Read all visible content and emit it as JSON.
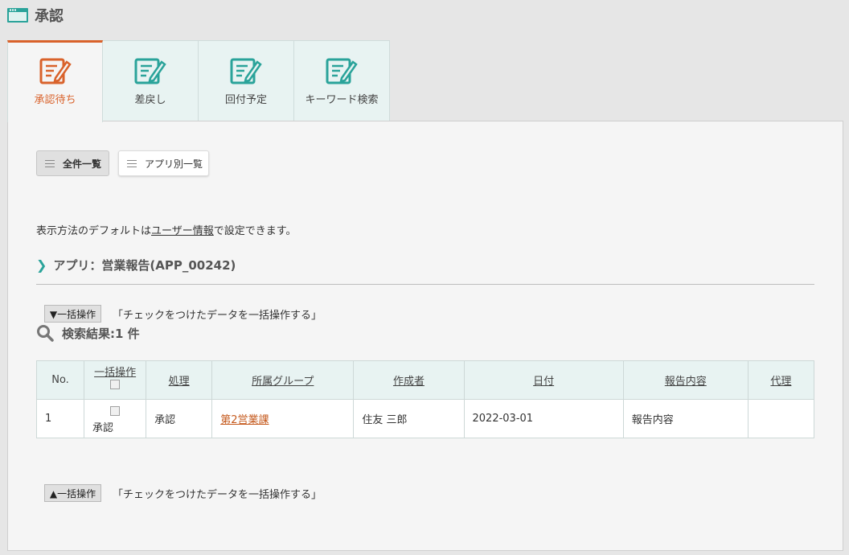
{
  "header": {
    "title": "承認",
    "icon": "window-icon",
    "accent": "#2aa39a"
  },
  "tabs": [
    {
      "label": "承認待ち",
      "icon": "edit-icon",
      "active": true
    },
    {
      "label": "差戻し",
      "icon": "edit-icon",
      "active": false
    },
    {
      "label": "回付予定",
      "icon": "edit-icon",
      "active": false
    },
    {
      "label": "キーワード検索",
      "icon": "edit-icon",
      "active": false
    }
  ],
  "view_buttons": {
    "all": "全件一覧",
    "by_app": "アプリ別一覧"
  },
  "info": {
    "prefix": "表示方法のデフォルトは",
    "link": "ユーザー情報",
    "suffix": "で設定できます。"
  },
  "app_heading": "アプリ：営業報告(APP_00242)",
  "bulk_top": {
    "button": "▼一括操作",
    "desc": "「チェックをつけたデータを一括操作する」"
  },
  "bulk_bottom": {
    "button": "▲一括操作",
    "desc": "「チェックをつけたデータを一括操作する」"
  },
  "result_title": "検索結果:1 件",
  "table": {
    "headers": [
      "No.",
      "一括操作",
      "処理",
      "所属グループ",
      "作成者",
      "日付",
      "報告内容",
      "代理"
    ],
    "rows": [
      {
        "no": "1",
        "bulk": "承認",
        "action": "承認",
        "group": "第2営業課",
        "author": "住友 三郎",
        "date": "2022-03-01",
        "report": "報告内容",
        "proxy": ""
      }
    ]
  },
  "colors": {
    "active_tab": "#d9622b",
    "teal": "#2aa39a",
    "link": "#c55a1e"
  }
}
